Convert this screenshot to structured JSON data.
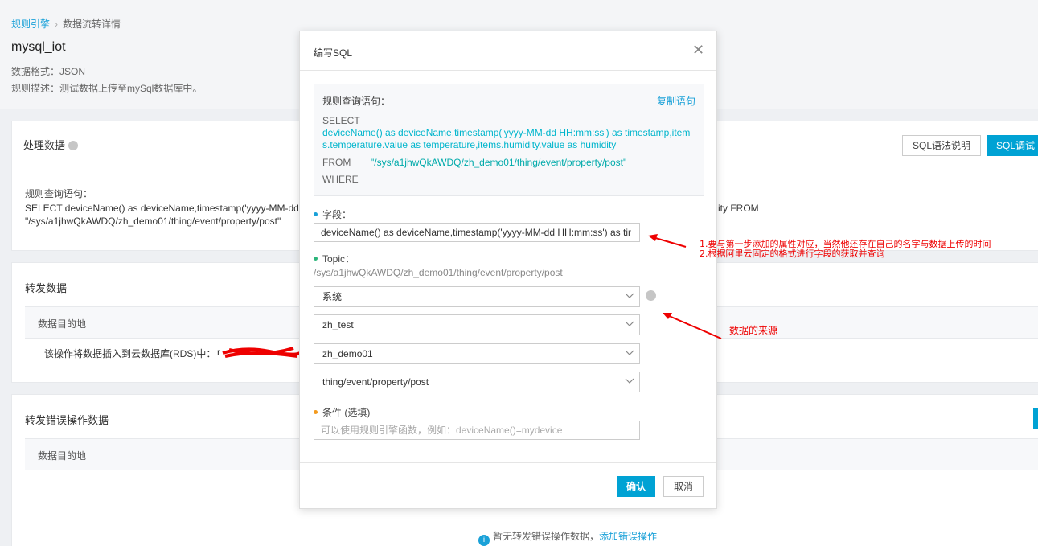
{
  "breadcrumb": {
    "root": "规则引擎",
    "current": "数据流转详情"
  },
  "page": {
    "title": "mysql_iot",
    "format": "数据格式：JSON",
    "description": "规则描述：测试数据上传至mySql数据库中。"
  },
  "process_section": {
    "title": "处理数据",
    "syntax_button": "SQL语法说明",
    "debug_button": "SQL调试",
    "query_label": "规则查询语句：",
    "query_line1": "SELECT deviceName() as deviceName,timestamp('yyyy-MM-dd",
    "query_line1_tail": "ity FROM",
    "query_line2": "\"/sys/a1jhwQkAWDQ/zh_demo01/thing/event/property/post\""
  },
  "forward_section": {
    "title": "转发数据",
    "col_header": "数据目的地",
    "row_text": "该操作将数据插入到云数据库(RDS)中：",
    "row_text_tail": "r"
  },
  "error_section": {
    "title": "转发错误操作数据",
    "col_header": "数据目的地",
    "empty_text": "暂无转发错误操作数据，",
    "empty_link": "添加错误操作"
  },
  "modal": {
    "title": "编写SQL",
    "query_label": "规则查询语句：",
    "copy_link": "复制语句",
    "select_kw": "SELECT",
    "select_expr_1": "deviceName() as deviceName,timestamp('yyyy-MM-dd HH:mm:ss') as timestamp,item",
    "select_expr_2": "s.temperature.value as temperature,items.humidity.value as humidity",
    "from_kw": "FROM",
    "from_topic": "\"/sys/a1jhwQkAWDQ/zh_demo01/thing/event/property/post\"",
    "where_kw": "WHERE",
    "field_label": "字段：",
    "field_value": "deviceName() as deviceName,timestamp('yyyy-MM-dd HH:mm:ss') as tir",
    "topic_label": "Topic：",
    "topic_value": "/sys/a1jhwQkAWDQ/zh_demo01/thing/event/property/post",
    "select_type": "系统",
    "select_product": "zh_test",
    "select_device": "zh_demo01",
    "select_topic": "thing/event/property/post",
    "condition_label": "条件 (选填)",
    "condition_placeholder": "可以使用规则引擎函数，例如：deviceName()=mydevice",
    "confirm_button": "确认",
    "cancel_button": "取消"
  },
  "annotations": {
    "note1": "1.要与第一步添加的属性对应，当然他还存在自己的名字与数据上传的时间",
    "note2": "2.根据阿里云固定的格式进行字段的获取并查询",
    "note3": "数据的来源"
  },
  "colors": {
    "accent": "#00a2d4",
    "link": "#1aa1d8",
    "annotation": "#ee0000",
    "cyan_code": "#00b5cc"
  }
}
